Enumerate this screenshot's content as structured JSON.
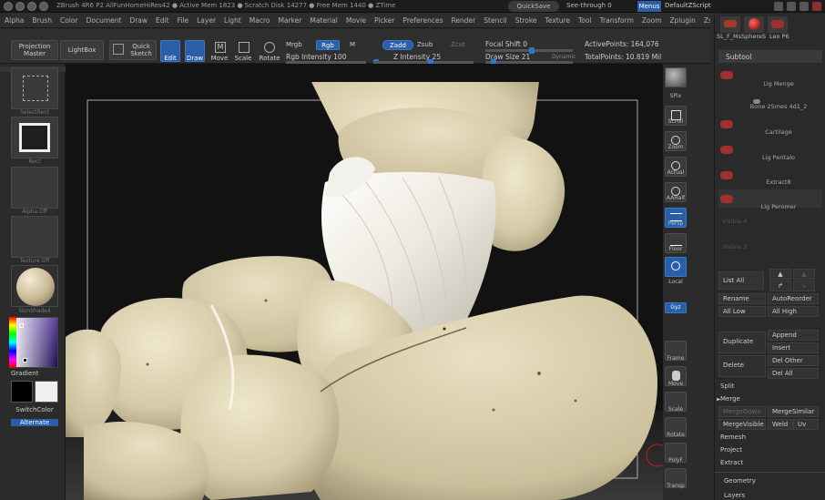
{
  "titlebar": {
    "title": "ZBrush 4R6 P2     AllFunHomeHiRes42   ● Active Mem 1823  ● Scratch Disk 14277  ● Free Mem 1440  ● ZTime",
    "quicksave": "QuickSave",
    "seethrough": "See-through  0",
    "menus": "Menus",
    "default_script": "DefaultZScript"
  },
  "menubar": [
    "Alpha",
    "Brush",
    "Color",
    "Document",
    "Draw",
    "Edit",
    "File",
    "Layer",
    "Light",
    "Macro",
    "Marker",
    "Material",
    "Movie",
    "Picker",
    "Preferences",
    "Render",
    "Stencil",
    "Stroke",
    "Texture",
    "Tool",
    "Transform",
    "Zoom",
    "Zplugin",
    "Zscript"
  ],
  "toolbar": {
    "projection_master": "Projection Master",
    "lightbox": "LightBox",
    "quick_sketch": "Quick Sketch",
    "edit": "Edit",
    "draw": "Draw",
    "move": "Move",
    "scale": "Scale",
    "rotate": "Rotate",
    "mrgb": "Mrgb",
    "rgb": "Rgb",
    "m": "M",
    "rgb_intensity": "Rgb Intensity 100",
    "zadd": "Zadd",
    "zsub": "Zsub",
    "zcut": "Zcut",
    "z_intensity": "Z Intensity 25",
    "focal_shift": "Focal Shift 0",
    "draw_size": "Draw Size 21",
    "dynamic": "Dynamic",
    "active_points": "ActivePoints: 164,076",
    "total_points": "TotalPoints: 10.819 Mil"
  },
  "leftshelf": {
    "select_rect": "SelectRect",
    "rect": "Rect",
    "alpha_off": "Alpha Off",
    "texture_off": "Texture Off",
    "material": "SkinShade4",
    "gradient": "Gradient",
    "switch_color": "SwitchColor",
    "alternate": "Alternate"
  },
  "rightshelf": [
    "SPix",
    "Scroll",
    "Zoom",
    "Actual",
    "AAHalf",
    "Persp",
    "Floor",
    "Local",
    "Gyz",
    "Frame",
    "Move",
    "Scale",
    "Rotate",
    "PolyF",
    "Transp"
  ],
  "rightpanel": {
    "tool_thumbs": [
      "SL_F_MsSphereS",
      "Leo P6"
    ],
    "subtool_title": "Subtool",
    "subtools": [
      "Lig Menge",
      "Bone 25mes 4d1_2",
      "Cartilage",
      "Lig Peritalo",
      "Extract8",
      "Lig Peromer",
      "Visible 4",
      "Visible 3"
    ],
    "list_all": "List All",
    "rename": "Rename",
    "auto_reorder": "AutoReorder",
    "all_low": "All Low",
    "all_high": "All High",
    "duplicate": "Duplicate",
    "append": "Append",
    "insert": "Insert",
    "delete": "Delete",
    "del_other": "Del Other",
    "del_all": "Del All",
    "split": "Split",
    "merge": "Merge",
    "merge_down": "MergeDown",
    "merge_similar": "MergeSimilar",
    "merge_visible": "MergeVisible",
    "weld": "Weld",
    "uv": "Uv",
    "remesh": "Remesh",
    "project": "Project",
    "extract": "Extract",
    "geometry": "Geometry",
    "layers": "Layers"
  },
  "colors": {
    "accent": "#2a5fa8",
    "bone": "#d8cfae",
    "ligament": "#e8e4da",
    "background": "#111111"
  }
}
